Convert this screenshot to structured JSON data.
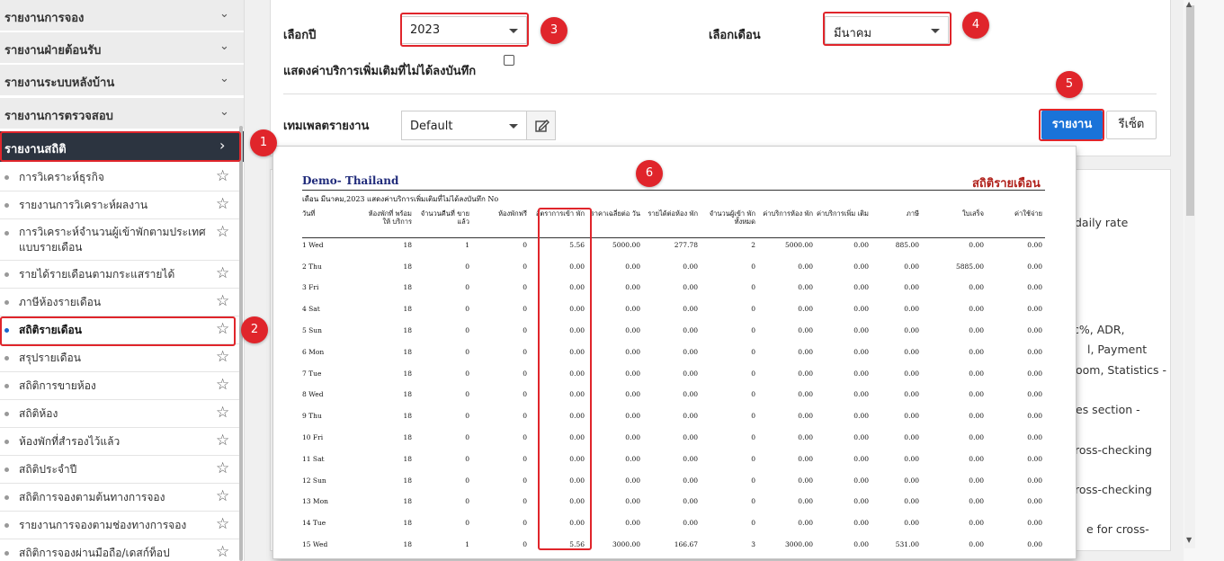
{
  "sidebar": {
    "sections": [
      {
        "label": "รายงานการจอง"
      },
      {
        "label": "รายงานฝ่ายต้อนรับ"
      },
      {
        "label": "รายงานระบบหลังบ้าน"
      },
      {
        "label": "รายงานการตรวจสอบ"
      },
      {
        "label": "รายงานสถิติ"
      }
    ],
    "items": [
      {
        "label": "การวิเคราะห์ธุรกิจ"
      },
      {
        "label": "รายงานการวิเคราะห์ผลงาน"
      },
      {
        "label": "การวิเคราะห์จำนวนผู้เข้าพักตามประเทศ แบบรายเดือน"
      },
      {
        "label": "รายได้รายเดือนตามกระแสรายได้"
      },
      {
        "label": "ภาษีห้องรายเดือน"
      },
      {
        "label": "สถิติรายเดือน"
      },
      {
        "label": "สรุปรายเดือน"
      },
      {
        "label": "สถิติการขายห้อง"
      },
      {
        "label": "สถิติห้อง"
      },
      {
        "label": "ห้องพักที่สำรองไว้แล้ว"
      },
      {
        "label": "สถิติประจำปี"
      },
      {
        "label": "สถิติการจองตามต้นทางการจอง"
      },
      {
        "label": "รายงานการจองตามช่องทางการจอง"
      },
      {
        "label": "สถิติการจองผ่านมือถือ/เดสก์ท็อป"
      }
    ]
  },
  "form": {
    "year_label": "เลือกปี",
    "year_value": "2023",
    "month_label": "เลือกเดือน",
    "month_value": "มีนาคม",
    "show_extra_label": "แสดงค่าบริการเพิ่มเติมที่ไม่ได้ลงบันทึก",
    "template_label": "เทมเพลตรายงาน",
    "template_value": "Default",
    "report_button": "รายงาน",
    "reset_button": "รีเซ็ต"
  },
  "badges": [
    "1",
    "2",
    "3",
    "4",
    "5",
    "6"
  ],
  "background_text": [
    "daily rate",
    "c%, ADR,",
    "l, Payment",
    "oom, Statistics -",
    "es section -",
    "ross-checking",
    "ross-checking",
    "e for cross-"
  ],
  "report": {
    "hotel": "Demo- Thailand",
    "title": "สถิติรายเดือน",
    "subtitle": "เดือน มีนาคม,2023   แสดงค่าบริการเพิ่มเติมที่ไม่ได้ลงบันทึก No",
    "columns": [
      "วันที่",
      "ห้องพักที่ พร้อมให้ บริการ",
      "จำนวนคืนที่ ขายแล้ว",
      "ห้องพักฟรี",
      "อัตราการเข้า พัก",
      "ราคาเฉลี่ยต่อ วัน",
      "รายได้ต่อห้อง พัก",
      "จำนวนผู้เข้า พักทั้งหมด",
      "ค่าบริการห้อง พัก",
      "ค่าบริการเพิ่ม เติม",
      "ภาษี",
      "ใบเสร็จ",
      "ค่าใช้จ่าย"
    ],
    "rows": [
      [
        "1 Wed",
        "18",
        "1",
        "0",
        "5.56",
        "5000.00",
        "277.78",
        "2",
        "5000.00",
        "0.00",
        "885.00",
        "0.00",
        "0.00"
      ],
      [
        "2 Thu",
        "18",
        "0",
        "0",
        "0.00",
        "0.00",
        "0.00",
        "0",
        "0.00",
        "0.00",
        "0.00",
        "5885.00",
        "0.00"
      ],
      [
        "3 Fri",
        "18",
        "0",
        "0",
        "0.00",
        "0.00",
        "0.00",
        "0",
        "0.00",
        "0.00",
        "0.00",
        "0.00",
        "0.00"
      ],
      [
        "4 Sat",
        "18",
        "0",
        "0",
        "0.00",
        "0.00",
        "0.00",
        "0",
        "0.00",
        "0.00",
        "0.00",
        "0.00",
        "0.00"
      ],
      [
        "5 Sun",
        "18",
        "0",
        "0",
        "0.00",
        "0.00",
        "0.00",
        "0",
        "0.00",
        "0.00",
        "0.00",
        "0.00",
        "0.00"
      ],
      [
        "6 Mon",
        "18",
        "0",
        "0",
        "0.00",
        "0.00",
        "0.00",
        "0",
        "0.00",
        "0.00",
        "0.00",
        "0.00",
        "0.00"
      ],
      [
        "7 Tue",
        "18",
        "0",
        "0",
        "0.00",
        "0.00",
        "0.00",
        "0",
        "0.00",
        "0.00",
        "0.00",
        "0.00",
        "0.00"
      ],
      [
        "8 Wed",
        "18",
        "0",
        "0",
        "0.00",
        "0.00",
        "0.00",
        "0",
        "0.00",
        "0.00",
        "0.00",
        "0.00",
        "0.00"
      ],
      [
        "9 Thu",
        "18",
        "0",
        "0",
        "0.00",
        "0.00",
        "0.00",
        "0",
        "0.00",
        "0.00",
        "0.00",
        "0.00",
        "0.00"
      ],
      [
        "10 Fri",
        "18",
        "0",
        "0",
        "0.00",
        "0.00",
        "0.00",
        "0",
        "0.00",
        "0.00",
        "0.00",
        "0.00",
        "0.00"
      ],
      [
        "11 Sat",
        "18",
        "0",
        "0",
        "0.00",
        "0.00",
        "0.00",
        "0",
        "0.00",
        "0.00",
        "0.00",
        "0.00",
        "0.00"
      ],
      [
        "12 Sun",
        "18",
        "0",
        "0",
        "0.00",
        "0.00",
        "0.00",
        "0",
        "0.00",
        "0.00",
        "0.00",
        "0.00",
        "0.00"
      ],
      [
        "13 Mon",
        "18",
        "0",
        "0",
        "0.00",
        "0.00",
        "0.00",
        "0",
        "0.00",
        "0.00",
        "0.00",
        "0.00",
        "0.00"
      ],
      [
        "14 Tue",
        "18",
        "0",
        "0",
        "0.00",
        "0.00",
        "0.00",
        "0",
        "0.00",
        "0.00",
        "0.00",
        "0.00",
        "0.00"
      ],
      [
        "15 Wed",
        "18",
        "1",
        "0",
        "5.56",
        "3000.00",
        "166.67",
        "3",
        "3000.00",
        "0.00",
        "531.00",
        "0.00",
        "0.00"
      ]
    ]
  },
  "colors": {
    "accent": "#1a73d9",
    "highlight": "#e0252b",
    "sidebar_active": "#2c3440"
  }
}
